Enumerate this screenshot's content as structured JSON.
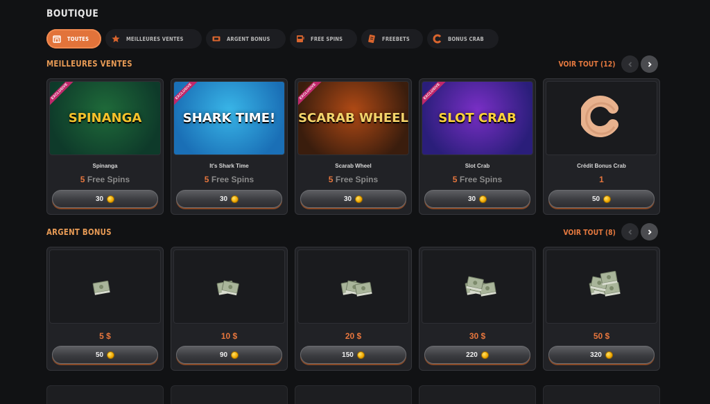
{
  "page": {
    "title": "BOUTIQUE"
  },
  "filters": [
    {
      "label": "TOUTES",
      "icon": "shop-icon",
      "active": true
    },
    {
      "label": "MEILLEURES VENTES",
      "icon": "star-icon",
      "active": false
    },
    {
      "label": "ARGENT BONUS",
      "icon": "ticket-icon",
      "active": false
    },
    {
      "label": "FREE SPINS",
      "icon": "slot-machine-icon",
      "active": false
    },
    {
      "label": "FREEBETS",
      "icon": "bet-slip-icon",
      "active": false
    },
    {
      "label": "BONUS CRAB",
      "icon": "crab-c-icon",
      "active": false
    }
  ],
  "best_sellers": {
    "title": "MEILLEURES VENTES",
    "see_all": "VOIR TOUT (12)",
    "items": [
      {
        "name": "Spinanga",
        "thumb_text": "SPINANGA",
        "exclusive": "EXCLUSIVE",
        "amount": "5",
        "amount_label": "Free Spins",
        "price": "30",
        "colors": [
          "#1f6b3a",
          "#0e3a2a",
          "#f3c22b"
        ]
      },
      {
        "name": "It's Shark Time",
        "thumb_text": "SHARK TIME!",
        "exclusive": "EXCLUSIVE",
        "amount": "5",
        "amount_label": "Free Spins",
        "price": "30",
        "colors": [
          "#39b6e8",
          "#1a6fb6",
          "#ffffff"
        ]
      },
      {
        "name": "Scarab Wheel",
        "thumb_text": "SCARAB WHEEL",
        "exclusive": "EXCLUSIVE",
        "amount": "5",
        "amount_label": "Free Spins",
        "price": "30",
        "colors": [
          "#b14a15",
          "#3a1d0d",
          "#f3d36a"
        ]
      },
      {
        "name": "Slot Crab",
        "thumb_text": "SLOT CRAB",
        "exclusive": "EXCLUSIVE",
        "amount": "5",
        "amount_label": "Free Spins",
        "price": "30",
        "colors": [
          "#7a2fc6",
          "#2a1e7a",
          "#ffd23a"
        ]
      },
      {
        "name": "Crédit Bonus Crab",
        "thumb_text": "",
        "exclusive": "",
        "amount": "1",
        "amount_label": "",
        "price": "50",
        "colors": [
          "#1a1b1e",
          "#1a1b1e",
          "#e8b28e"
        ]
      }
    ]
  },
  "bonus_money": {
    "title": "ARGENT BONUS",
    "see_all": "VOIR TOUT (8)",
    "items": [
      {
        "amount": "5 $",
        "price": "50",
        "stacks": 1
      },
      {
        "amount": "10 $",
        "price": "90",
        "stacks": 2
      },
      {
        "amount": "20 $",
        "price": "150",
        "stacks": 3
      },
      {
        "amount": "30 $",
        "price": "220",
        "stacks": 4
      },
      {
        "amount": "50 $",
        "price": "320",
        "stacks": 5
      }
    ]
  },
  "theme": {
    "accent": "#e2733a",
    "section_title": "#e79a55",
    "see_all": "#e6793f",
    "card_bg": "#212226",
    "page_bg": "#111214"
  }
}
